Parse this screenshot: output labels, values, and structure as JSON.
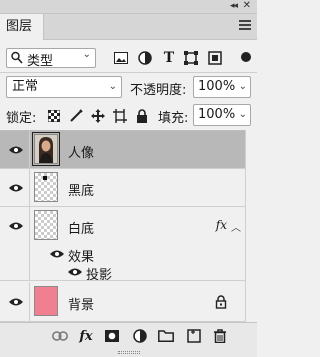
{
  "panel": {
    "tab_title": "图层"
  },
  "filter": {
    "kind_label": "类型",
    "icons": [
      "pixel-filter-icon",
      "adjustment-filter-icon",
      "type-filter-icon",
      "shape-filter-icon",
      "smart-object-filter-icon"
    ]
  },
  "blend": {
    "mode": "正常",
    "opacity_label": "不透明度:",
    "opacity_value": "100%"
  },
  "lock": {
    "label": "锁定:",
    "fill_label": "填充:",
    "fill_value": "100%"
  },
  "layers": [
    {
      "name": "人像",
      "selected": true,
      "thumb": "photo"
    },
    {
      "name": "黑底",
      "selected": false,
      "thumb": "transparent"
    },
    {
      "name": "白底",
      "selected": false,
      "thumb": "transparent",
      "fx": "fx",
      "effects_label": "效果",
      "effects": [
        "投影"
      ]
    },
    {
      "name": "背景",
      "selected": false,
      "thumb": "solid",
      "color": "#f08090",
      "locked": true
    }
  ],
  "colors": {
    "selected_row": "#b8b8b8",
    "background_swatch": "#f08090",
    "panel_bg": "#f0f0f0"
  }
}
